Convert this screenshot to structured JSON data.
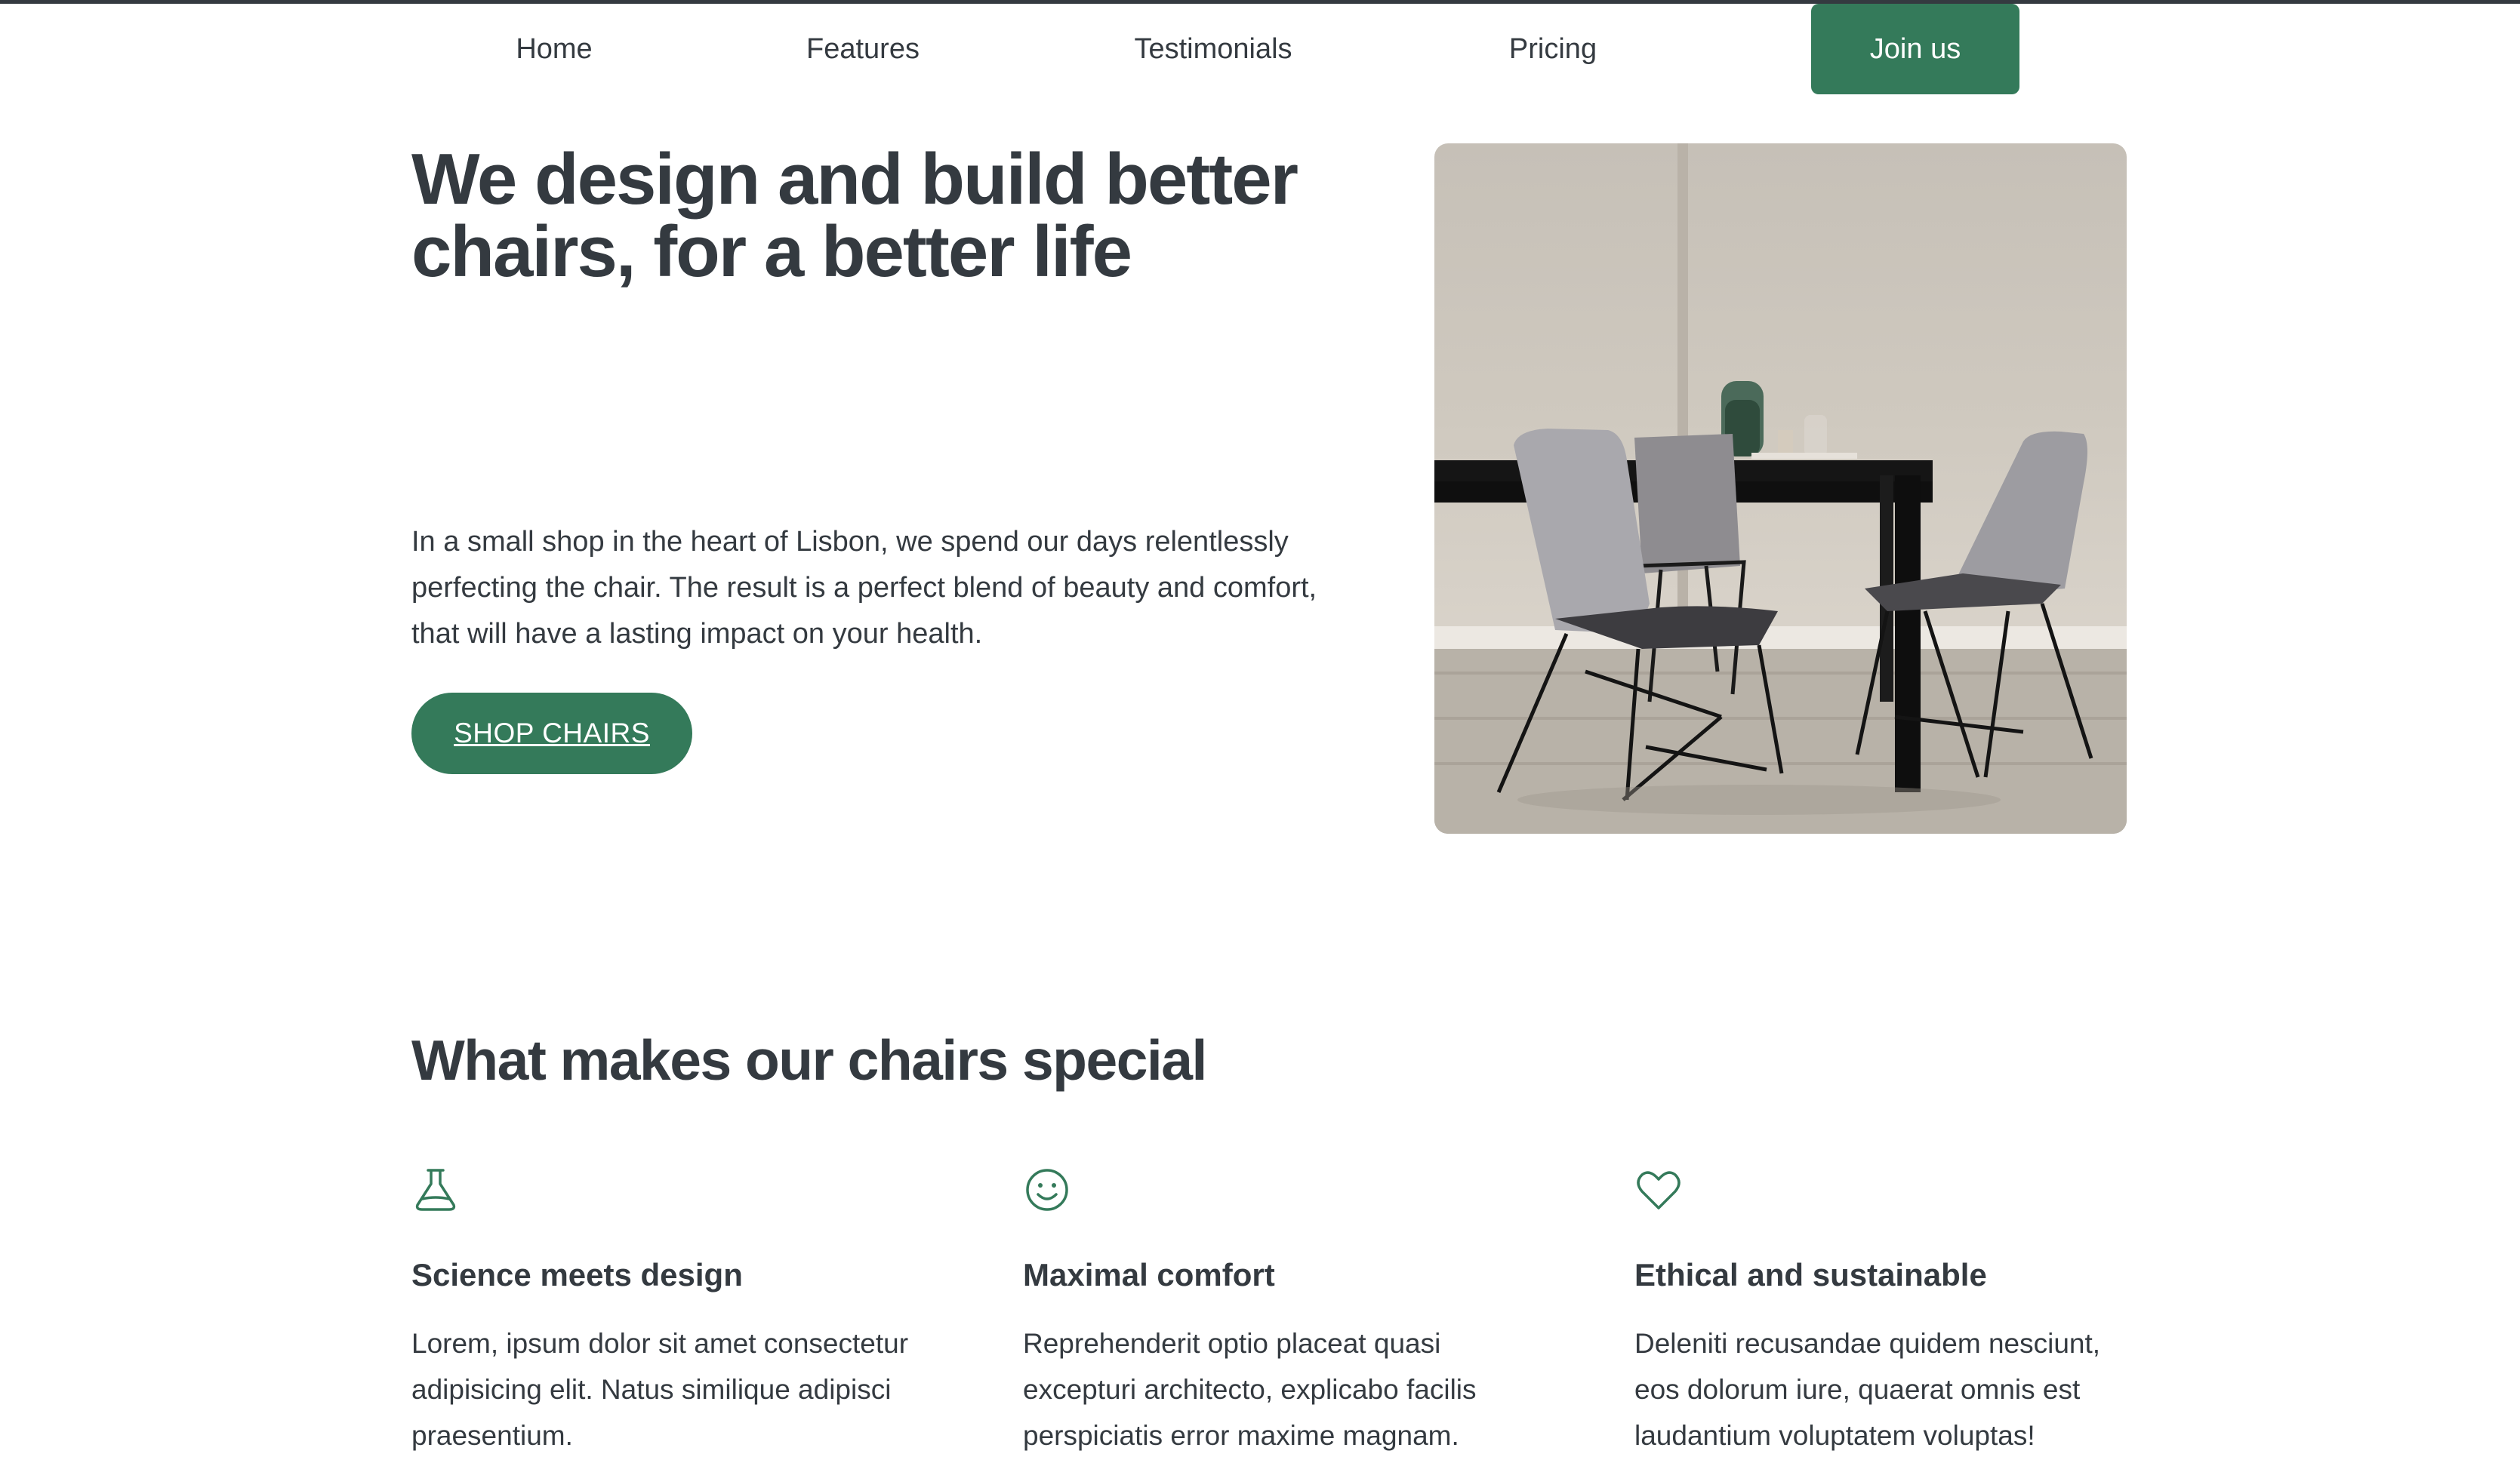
{
  "nav": {
    "items": [
      {
        "label": "Home"
      },
      {
        "label": "Features"
      },
      {
        "label": "Testimonials"
      },
      {
        "label": "Pricing"
      }
    ],
    "cta_label": "Join us"
  },
  "hero": {
    "title": "We design and build better chairs, for a better life",
    "description": "In a small shop in the heart of Lisbon, we spend our days relentlessly perfecting the chair. The result is a perfect blend of beauty and comfort, that will have a lasting impact on your health.",
    "button_label": "SHOP CHAIRS",
    "image_icon": "dining-chairs-photo"
  },
  "features": {
    "title": "What makes our chairs special",
    "items": [
      {
        "icon": "flask-icon",
        "title": "Science meets design",
        "text": "Lorem, ipsum dolor sit amet consectetur adipisicing elit. Natus similique adipisci praesentium."
      },
      {
        "icon": "smile-icon",
        "title": "Maximal comfort",
        "text": "Reprehenderit optio placeat quasi excepturi architecto, explicabo facilis perspiciatis error maxime magnam."
      },
      {
        "icon": "heart-icon",
        "title": "Ethical and sustainable",
        "text": "Deleniti recusandae quidem nesciunt, eos dolorum iure, quaerat omnis est laudantium voluptatem voluptas!"
      }
    ]
  },
  "colors": {
    "accent": "#347a5a",
    "text": "#343a40",
    "background": "#ffffff"
  }
}
